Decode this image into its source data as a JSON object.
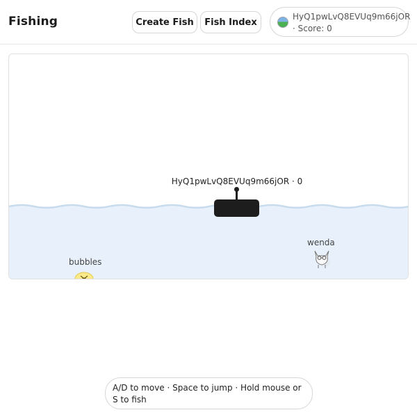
{
  "header": {
    "title": "Fishing",
    "create_fish_label": "Create Fish",
    "fish_index_label": "Fish Index",
    "user": {
      "name": "HyQ1pwLvQ8EVUq9m66jOR",
      "score_text": "· Score: 0",
      "avatar_icon": "globe-avatar-icon"
    }
  },
  "game": {
    "player_label": "HyQ1pwLvQ8EVUq9m66jOR · 0",
    "fishes": [
      {
        "name": "wenda",
        "icon": "cat-fish-icon"
      },
      {
        "name": "bubbles",
        "icon": "yellow-fish-icon"
      }
    ],
    "colors": {
      "water": "#e8f1fb",
      "wave": "#c9dcee",
      "boat": "#1d1d1d"
    }
  },
  "footer": {
    "hint": "A/D to move · Space to jump · Hold mouse or S to fish"
  }
}
